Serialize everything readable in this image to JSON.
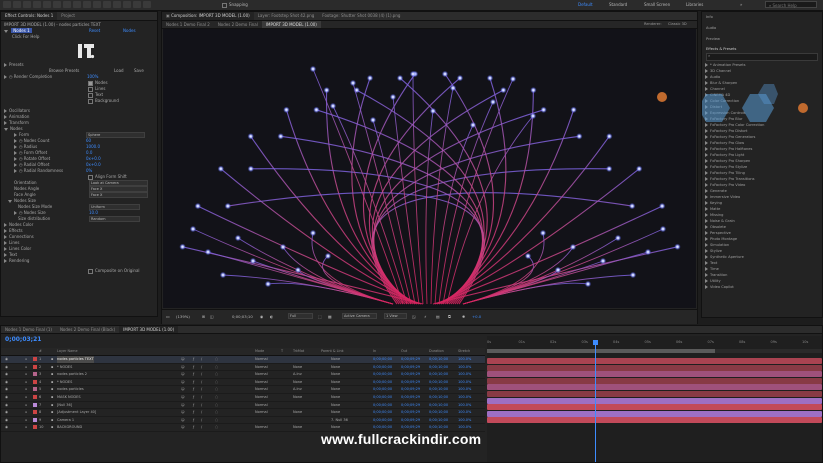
{
  "topbar": {
    "snapping": "Snapping",
    "workspaces": [
      "Default",
      "Standard",
      "Small Screen",
      "Libraries"
    ],
    "search_placeholder": "Search Help"
  },
  "effect_controls": {
    "tabs": [
      "Effect Controls: Nodes 1",
      "Project"
    ],
    "layer_path": "IMPORT 3D MODEL (1.00) - nodes particles TEXT",
    "effect_header": "Nodes 1",
    "header_links": [
      "Reset",
      "Nodes"
    ],
    "click_help": "Click For Help",
    "presets_label": "Presets",
    "preset_buttons": [
      "Browse Presets",
      "Load",
      "Save"
    ],
    "render_completion_label": "Render Completion",
    "render_completion_value": "100%",
    "checkboxes": [
      "Nodes",
      "Lines",
      "Text",
      "Background"
    ],
    "sections_a": [
      "Oscillators",
      "Animation",
      "Transform"
    ],
    "nodes_section": "Nodes",
    "node_props": [
      {
        "label": "Form",
        "value": "Sphere",
        "type": "dropdown"
      },
      {
        "label": "Nodes Count",
        "value": "60",
        "type": "number"
      },
      {
        "label": "Radius",
        "value": "1000.0",
        "type": "number"
      },
      {
        "label": "Form Offset",
        "value": "0.0",
        "type": "number"
      },
      {
        "label": "Rotate Offset",
        "value": "0x+0.0",
        "type": "number"
      },
      {
        "label": "Radial Offset",
        "value": "0x+0.0",
        "type": "number"
      },
      {
        "label": "Radial Randomness",
        "value": "0%",
        "type": "number"
      }
    ],
    "align_label": "Align Form Shift",
    "orientation_label": "Orientation",
    "orientation_value": "Look at Camera",
    "nodes_angle_label": "Nodes Angle",
    "nodes_angle_value": "Face X",
    "face_angle_label": "Face Angle",
    "face_angle_value": "Face X",
    "nodes_size_section": "Nodes Size",
    "nodes_size_mode_label": "Nodes Size Mode",
    "nodes_size_mode_value": "Uniform",
    "nodes_size_label": "Nodes Size",
    "nodes_size_value": "10.0",
    "size_distribution_label": "Size distribution",
    "size_distribution_value": "Random",
    "sections_b": [
      "Nodes Color",
      "Effects",
      "Connections",
      "Lines",
      "Lines Color",
      "Text",
      "Rendering"
    ],
    "composite_label": "Composite on Original"
  },
  "composition": {
    "tabs": [
      "Composition: IMPORT 3D MODEL (1.00)",
      "Layer: Footstep Shot 42.png",
      "Footage: Shutter Shot 0038 (4) (1).png"
    ],
    "subtabs": [
      "Nodes 1 Demo Final 2",
      "Nodes 2 Demo Final",
      "IMPORT 3D MODEL (1.00)"
    ],
    "renderer_label": "Renderer:",
    "renderer_value": "Classic 3D",
    "zoom": "(139%)",
    "timecode": "0;00;03;10",
    "resolution": "Full",
    "camera": "Active Camera",
    "views": "1 View",
    "offset": "+0.0"
  },
  "effects_presets": {
    "panel_labels": [
      "Info",
      "Audio",
      "Preview"
    ],
    "title": "Effects & Presets",
    "search_placeholder": "",
    "items": [
      "* Animation Presets",
      "3D Channel",
      "Audio",
      "Blur & Sharpen",
      "Channel",
      "CINEMA 4D",
      "Color Correction",
      "Distort",
      "Expression Controls",
      "FxFactory Pro Blur",
      "FxFactory Pro Color Correction",
      "FxFactory Pro Distort",
      "FxFactory Pro Generators",
      "FxFactory Pro Glow",
      "FxFactory Pro Halftones",
      "FxFactory Pro Light",
      "FxFactory Pro Sharpen",
      "FxFactory Pro Stylize",
      "FxFactory Pro Tiling",
      "FxFactory Pro Transitions",
      "FxFactory Pro Video",
      "Generate",
      "Immersive Video",
      "Keying",
      "Matte",
      "Missing",
      "Noise & Grain",
      "Obsolete",
      "Perspective",
      "Photo Montage",
      "Simulation",
      "Stylize",
      "Synthetic Aperture",
      "Text",
      "Time",
      "Transition",
      "Utility",
      "Video Copilot"
    ]
  },
  "timeline": {
    "tabs": [
      "Nodes 1 Demo Final (1)",
      "Nodes 2 Demo Final (Black)",
      "IMPORT 3D MODEL (1.00)"
    ],
    "timecode": "0;00;03;21",
    "columns": [
      "#",
      "Layer Name",
      "Mode",
      "T",
      "TrkMat",
      "Parent & Link",
      "In",
      "Out",
      "Duration",
      "Stretch"
    ],
    "layers": [
      {
        "num": "1",
        "name": "nodes particles TEXT",
        "mode": "Normal",
        "trkmat": "",
        "parent": "None",
        "inp": "0;00;00;00",
        "out": "0;00;09;29",
        "dur": "0;00;10;00",
        "stretch": "100.0%"
      },
      {
        "num": "2",
        "name": "* NODES",
        "mode": "Normal",
        "trkmat": "None",
        "parent": "None",
        "inp": "0;00;00;00",
        "out": "0;00;09;29",
        "dur": "0;00;10;00",
        "stretch": "100.0%"
      },
      {
        "num": "3",
        "name": "nodes particles 2",
        "mode": "Normal",
        "trkmat": "A.Inv",
        "parent": "None",
        "inp": "0;00;00;00",
        "out": "0;00;09;29",
        "dur": "0;00;10;00",
        "stretch": "100.0%"
      },
      {
        "num": "4",
        "name": "* NODES",
        "mode": "Normal",
        "trkmat": "None",
        "parent": "None",
        "inp": "0;00;00;00",
        "out": "0;00;09;29",
        "dur": "0;00;10;00",
        "stretch": "100.0%"
      },
      {
        "num": "5",
        "name": "nodes particles",
        "mode": "Normal",
        "trkmat": "A.Inv",
        "parent": "None",
        "inp": "0;00;00;00",
        "out": "0;00;09;29",
        "dur": "0;00;10;00",
        "stretch": "100.0%"
      },
      {
        "num": "6",
        "name": "MASK NODES",
        "mode": "Normal",
        "trkmat": "None",
        "parent": "None",
        "inp": "0;00;00;00",
        "out": "0;00;09;29",
        "dur": "0;00;10;00",
        "stretch": "100.0%"
      },
      {
        "num": "7",
        "name": "[Null 36]",
        "mode": "Normal",
        "trkmat": "",
        "parent": "None",
        "inp": "0;00;00;00",
        "out": "0;00;09;29",
        "dur": "0;00;10;00",
        "stretch": "100.0%"
      },
      {
        "num": "8",
        "name": "[Adjustment Layer 40]",
        "mode": "Normal",
        "trkmat": "None",
        "parent": "None",
        "inp": "0;00;00;00",
        "out": "0;00;09;29",
        "dur": "0;00;10;00",
        "stretch": "100.0%"
      },
      {
        "num": "9",
        "name": "Camera 1",
        "mode": "",
        "trkmat": "",
        "parent": "7. Null 36",
        "inp": "0;00;00;00",
        "out": "0;00;09;29",
        "dur": "0;00;10;00",
        "stretch": "100.0%"
      },
      {
        "num": "10",
        "name": "BACKGROUND",
        "mode": "Normal",
        "trkmat": "None",
        "parent": "None",
        "inp": "0;00;00;00",
        "out": "0;00;09;29",
        "dur": "0;00;10;00",
        "stretch": "100.0%"
      }
    ],
    "ruler": [
      "0s",
      "01s",
      "02s",
      "03s",
      "04s",
      "05s",
      "06s",
      "07s",
      "08s",
      "09s",
      "10s"
    ]
  },
  "watermark": "www.fullcrackindir.com",
  "colors": {
    "accent": "#3d8cff",
    "bar_red": "#c24a5a",
    "bar_pink": "#b65a8c",
    "bar_purple": "#9e6fc4"
  }
}
